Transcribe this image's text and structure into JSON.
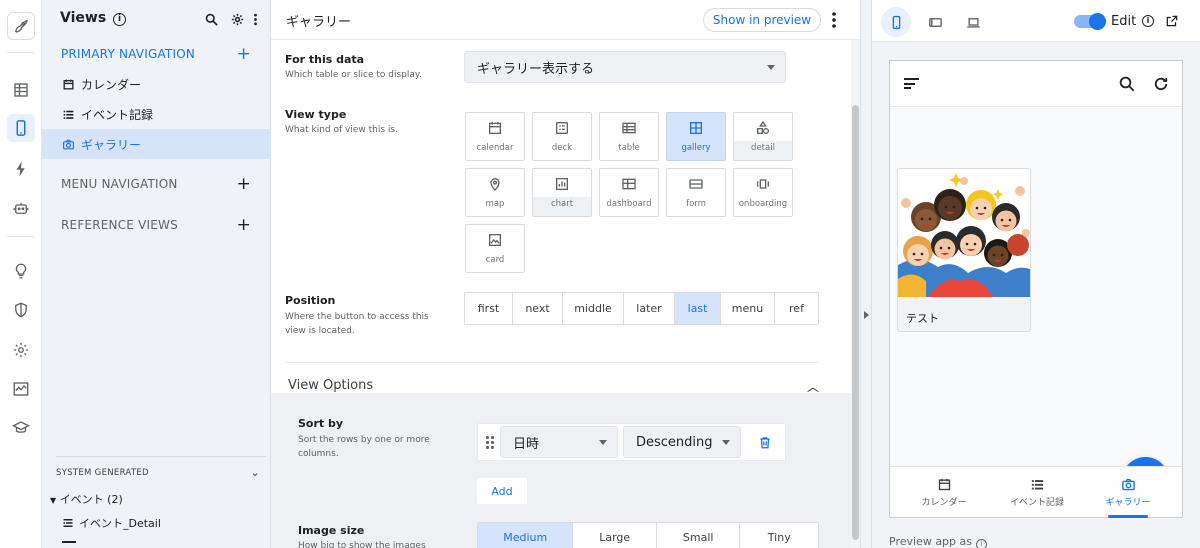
{
  "views_panel": {
    "title": "Views",
    "primary_navigation": "PRIMARY NAVIGATION",
    "primary_items": [
      "カレンダー",
      "イベント記録",
      "ギャラリー"
    ],
    "menu_navigation": "MENU NAVIGATION",
    "reference_views": "REFERENCE VIEWS",
    "system_generated": "SYSTEM GENERATED",
    "tree_group": "イベント (2)",
    "tree_item": "イベント_Detail"
  },
  "editor": {
    "title": "ギャラリー",
    "show_in_preview": "Show in preview",
    "for_this_data": {
      "label": "For this data",
      "desc": "Which table or slice to display.",
      "value": "ギャラリー表示する"
    },
    "view_type": {
      "label": "View type",
      "desc": "What kind of view this is.",
      "options": [
        "calendar",
        "deck",
        "table",
        "gallery",
        "detail",
        "map",
        "chart",
        "dashboard",
        "form",
        "onboarding",
        "card"
      ],
      "selected": "gallery"
    },
    "position": {
      "label": "Position",
      "desc": "Where the button to access this view is located.",
      "options": [
        "first",
        "next",
        "middle",
        "later",
        "last",
        "menu",
        "ref"
      ],
      "selected": "last"
    },
    "view_options": "View Options",
    "sort_by": {
      "label": "Sort by",
      "desc": "Sort the rows by one or more columns.",
      "column": "日時",
      "direction": "Descending",
      "add": "Add"
    },
    "image_size": {
      "label": "Image size",
      "desc": "How big to show the images",
      "options": [
        "Medium",
        "Large",
        "Small",
        "Tiny"
      ],
      "selected": "Medium"
    }
  },
  "preview": {
    "edit_label": "Edit",
    "card_label": "テスト",
    "tabs": [
      "カレンダー",
      "イベント記録",
      "ギャラリー"
    ],
    "active_tab": "ギャラリー",
    "footer": "Preview app as"
  },
  "colors": {
    "accent": "#1a73e8",
    "selected_bg": "#d6e4fb",
    "panel_bg": "#eff2f7"
  }
}
